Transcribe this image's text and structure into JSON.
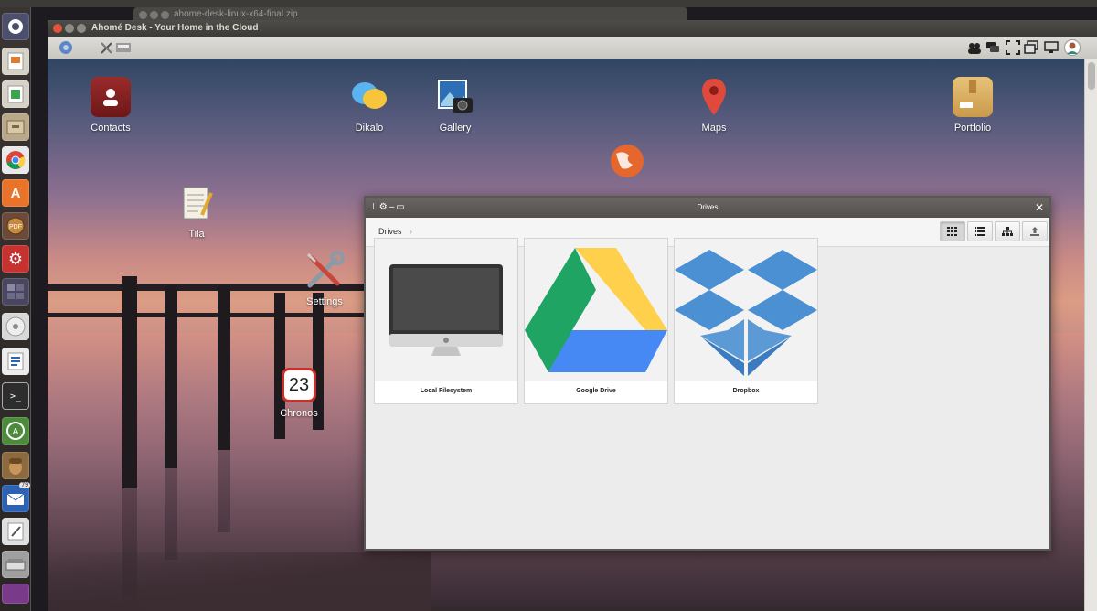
{
  "background_window": {
    "title": "ahome-desk-linux-x64-final.zip"
  },
  "app_window": {
    "title": "Ahomé Desk - Your Home in the Cloud"
  },
  "desktop_icons": [
    {
      "label": "Contacts"
    },
    {
      "label": "Dikalo"
    },
    {
      "label": "Gallery"
    },
    {
      "label": "Maps"
    },
    {
      "label": "Portfolio"
    },
    {
      "label": "Tila"
    },
    {
      "label": "Settings"
    },
    {
      "label": "Chronos",
      "day": "23"
    }
  ],
  "drives_window": {
    "title": "Drives",
    "breadcrumb": "Drives",
    "breadcrumb_sep": "›",
    "drives": [
      {
        "label": "Local Filesystem"
      },
      {
        "label": "Google Drive"
      },
      {
        "label": "Dropbox"
      }
    ],
    "close_glyph": "✕"
  },
  "launcher": {
    "thunderbird_badge": "79"
  },
  "colors": {
    "titlebar": "#3c3b37",
    "drive_green": "#1fa463",
    "drive_yellow": "#ffd04b",
    "drive_blue": "#4688f4",
    "dropbox_blue": "#4a90d2"
  },
  "icons": [
    "ubuntu-icon",
    "impress-icon",
    "calc-icon",
    "archive-icon",
    "chrome-icon",
    "software-center-icon",
    "gear-icon",
    "disc-icon",
    "writer-icon",
    "terminal-icon",
    "update-icon",
    "acorn-icon",
    "thunderbird-icon",
    "text-editor-icon",
    "scanner-icon"
  ]
}
